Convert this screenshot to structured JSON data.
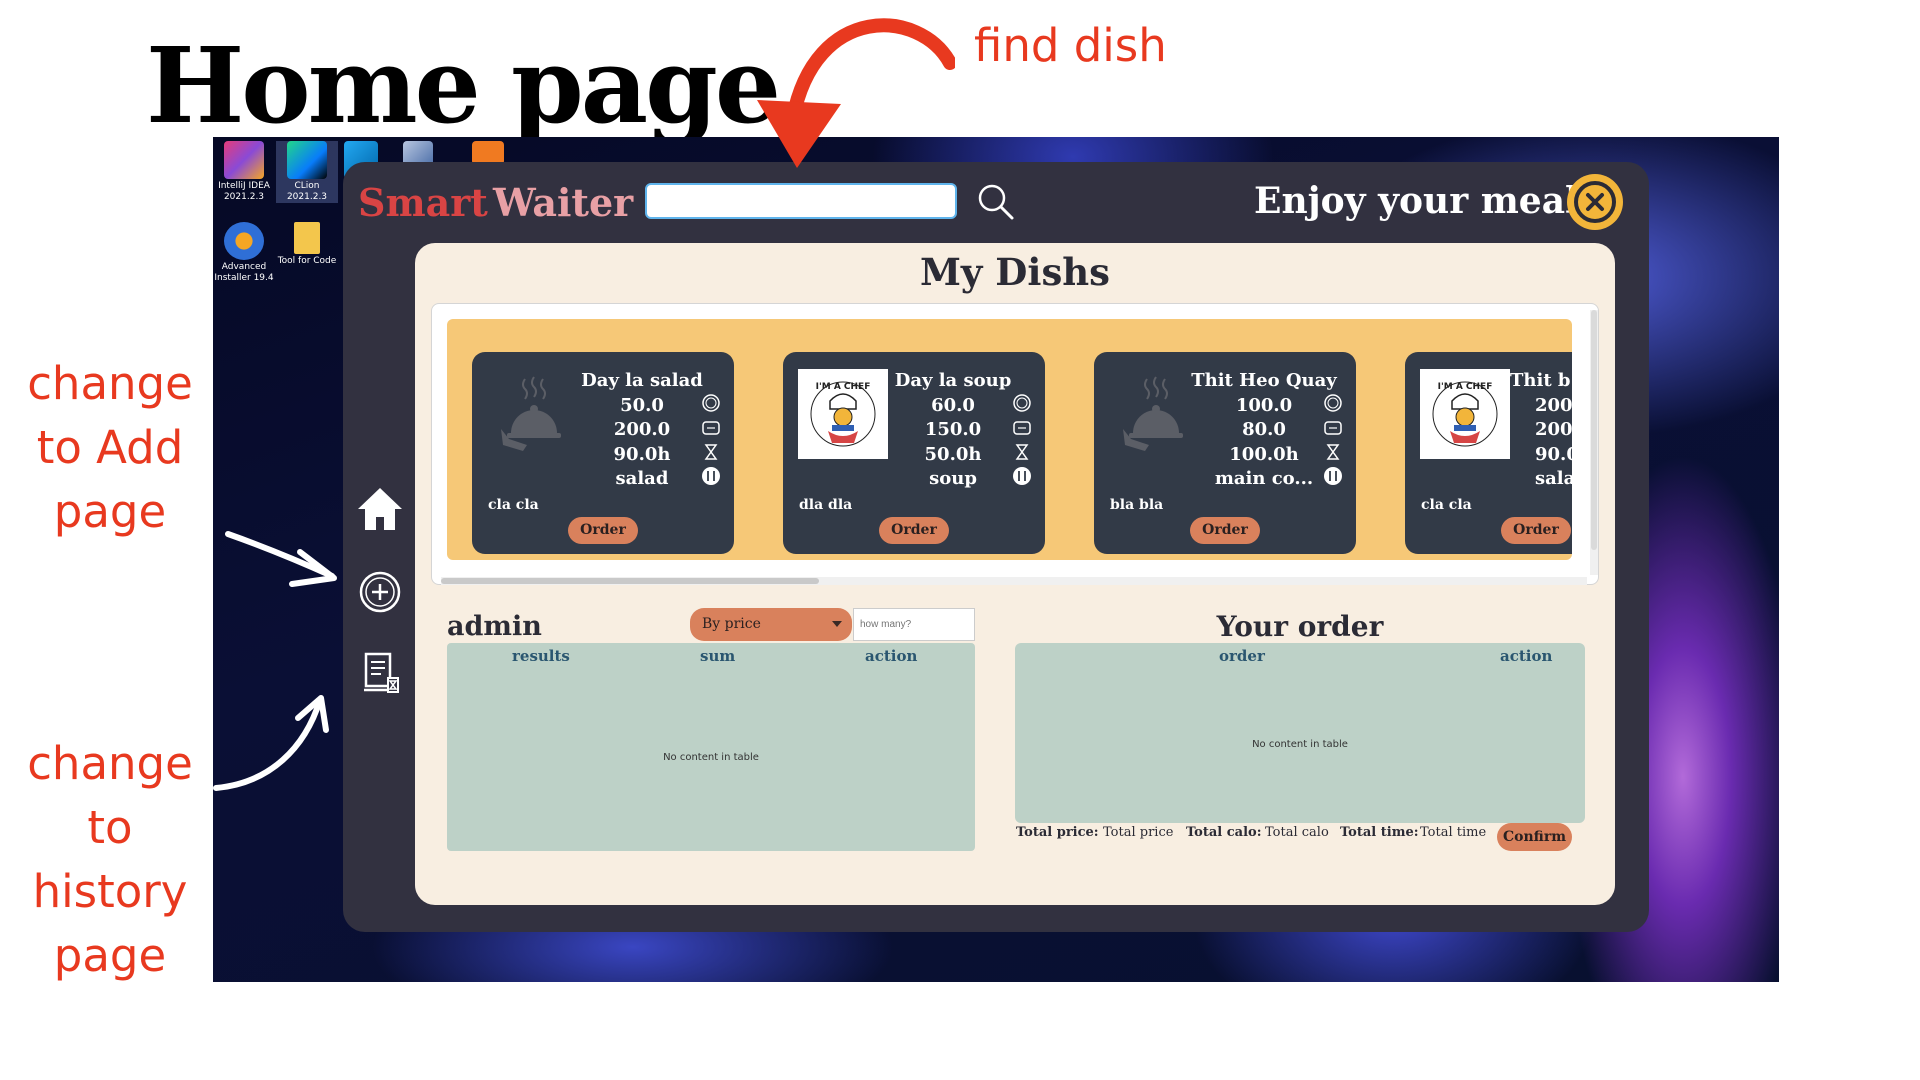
{
  "headline": "Home page",
  "annotations": {
    "find_dish": "find dish",
    "add_page": [
      "change",
      "to Add",
      "page"
    ],
    "history_page": [
      "change",
      "to history",
      "page"
    ]
  },
  "desktop_icons": [
    {
      "label": "IntelliJ IDEA 2021.2.3",
      "color": "#e53c7a"
    },
    {
      "label": "CLion 2021.2.3",
      "color": "#21d789"
    },
    {
      "label": "Advanced Installer 19.4",
      "color": "#2f6fd6"
    },
    {
      "label": "Tool for Code",
      "color": "#f3c64c"
    }
  ],
  "header": {
    "brand_smart": "Smart",
    "brand_waiter": "Waiter",
    "search_value": "",
    "greeting": "Enjoy your meal!",
    "search_icon": "search-icon",
    "close_icon": "close-circle-icon"
  },
  "sidebar": {
    "items": [
      {
        "name": "home",
        "icon": "home-icon"
      },
      {
        "name": "add",
        "icon": "plus-circle-icon"
      },
      {
        "name": "history",
        "icon": "history-list-icon"
      }
    ]
  },
  "main": {
    "title": "My Dishs",
    "dishes": [
      {
        "name": "Day la salad",
        "price": "50.0",
        "calo": "200.0",
        "time": "90.0h",
        "type": "salad",
        "desc": "cla cla",
        "image": "cloche-icon",
        "order_label": "Order"
      },
      {
        "name": "Day la soup",
        "price": "60.0",
        "calo": "150.0",
        "time": "50.0h",
        "type": "soup",
        "desc": "dla dla",
        "image": "chef-logo",
        "order_label": "Order"
      },
      {
        "name": "Thit Heo Quay",
        "price": "100.0",
        "calo": "80.0",
        "time": "100.0h",
        "type": "main co...",
        "desc": "bla bla",
        "image": "cloche-icon",
        "order_label": "Order"
      },
      {
        "name": "Thit b",
        "price": "200",
        "calo": "200",
        "time": "90.0",
        "type": "sala",
        "desc": "cla cla",
        "image": "chef-logo",
        "order_label": "Order"
      }
    ],
    "chef_logo_text": "I'M A CHEF · I DON'T MIND COOKING"
  },
  "admin": {
    "label": "admin",
    "sort_selected": "By price",
    "howmany_placeholder": "how many?",
    "columns": [
      "results",
      "sum",
      "action"
    ],
    "empty_text": "No content in table"
  },
  "order": {
    "title": "Your order",
    "columns": [
      "order",
      "action"
    ],
    "empty_text": "No content in table",
    "totals": [
      {
        "label": "Total price:",
        "value": "Total price"
      },
      {
        "label": "Total calo:",
        "value": "Total calo"
      },
      {
        "label": "Total time:",
        "value": "Total time"
      }
    ],
    "confirm_label": "Confirm"
  },
  "colors": {
    "accent_red": "#e8391f",
    "window_bg": "#323140",
    "panel_bg": "#f8eee1",
    "strip_bg": "#f6c877",
    "card_bg": "#323a47",
    "button_orange": "#d9815c",
    "table_bg": "#bdd1c7",
    "close_yellow": "#f2b53a"
  }
}
